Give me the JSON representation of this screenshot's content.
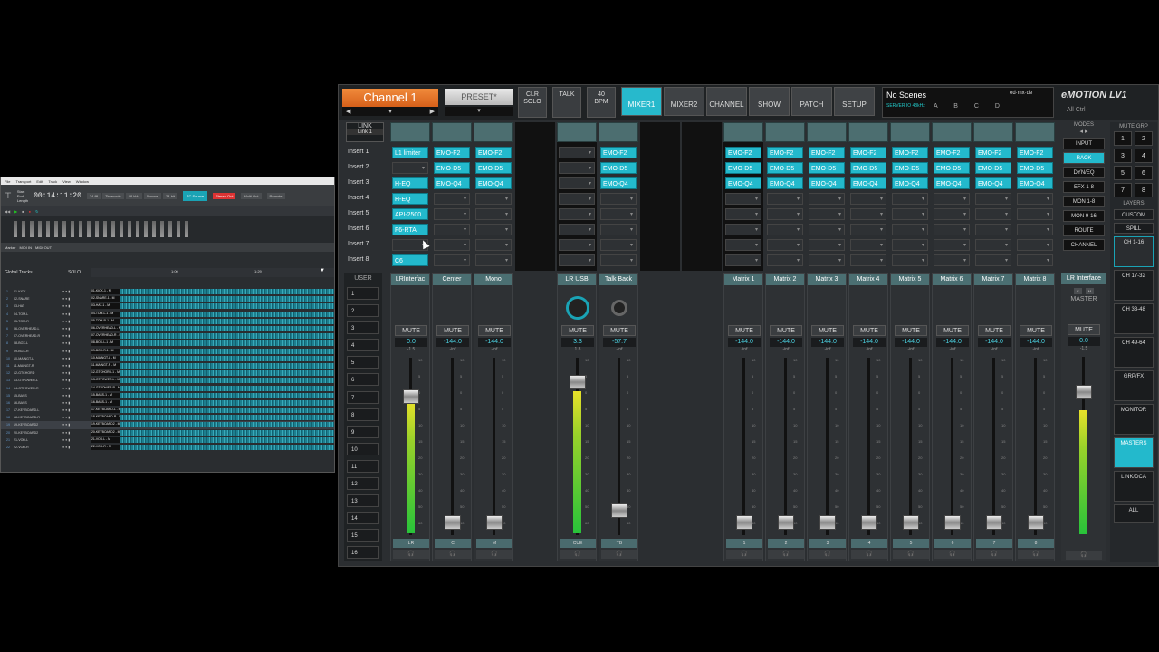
{
  "daw": {
    "menu": [
      "File",
      "Transport",
      "Edit",
      "Track",
      "View",
      "Window"
    ],
    "timecode": "00:14:11:20",
    "fields": [
      "Start",
      "End",
      "Length"
    ],
    "info_boxes": [
      "24 fill",
      "Timecode",
      "48 kHz",
      "Normal",
      "24-bit"
    ],
    "tc_source": "TC Source",
    "stereo_out": "Stereo Out",
    "multi_out": "Multi Out",
    "remote": "Remote",
    "marker_items": [
      "Marker",
      "MIDI IN",
      "MIDI OUT"
    ],
    "global_tracks": "Global Tracks",
    "solo": "SOLO",
    "ruler": [
      "1:00",
      "1:29"
    ],
    "tracks": [
      {
        "num": "1",
        "name": "01-KICK",
        "clip": "01-KICK-1 - M"
      },
      {
        "num": "2",
        "name": "02-SNARE",
        "clip": "02-SNARE-1 - M"
      },
      {
        "num": "3",
        "name": "03-HAT",
        "clip": "03-HAT-1 - M"
      },
      {
        "num": "4",
        "name": "04-TOM-L",
        "clip": "04-TOM-L-1 - M"
      },
      {
        "num": "5",
        "name": "05-TOM-R",
        "clip": "05-TOM-R-1 - M"
      },
      {
        "num": "6",
        "name": "06-OVERHEAD-L",
        "clip": "06-OVERHEAD-L - M"
      },
      {
        "num": "7",
        "name": "07-OVERHEAD-R",
        "clip": "07-OVERHEAD-R - M"
      },
      {
        "num": "8",
        "name": "08-BOX-L",
        "clip": "08-BOX-L-1 - M"
      },
      {
        "num": "9",
        "name": "09-BOX-R",
        "clip": "09-BOX-R-1 - M"
      },
      {
        "num": "10",
        "name": "10-MAINGT-L",
        "clip": "10-MAINGT-L - M"
      },
      {
        "num": "11",
        "name": "11-MAINGT-R",
        "clip": "11-MAINGT-R - M"
      },
      {
        "num": "12",
        "name": "12-GTCHORD",
        "clip": "12-GTCHORD-1 - M"
      },
      {
        "num": "13",
        "name": "13-GTPOWER-L",
        "clip": "13-GTPOWER-L - M"
      },
      {
        "num": "14",
        "name": "14-GTPOWER-R",
        "clip": "14-GTPOWER-R - M"
      },
      {
        "num": "15",
        "name": "15-BASS",
        "clip": "15-BASS-1 - M"
      },
      {
        "num": "16",
        "name": "16-BASS",
        "clip": "16-BASS-1 - M"
      },
      {
        "num": "17",
        "name": "17-KEYBOARD-L",
        "clip": "17-KEYBOARD-L - M"
      },
      {
        "num": "18",
        "name": "18-KEYBOARD-R",
        "clip": "18-KEYBOARD-R - M"
      },
      {
        "num": "19",
        "name": "19-KEYBOARD2",
        "clip": "19-KEYBOARD2 - M"
      },
      {
        "num": "20",
        "name": "20-KEYBOARD2",
        "clip": "20-KEYBOARD2 - M"
      },
      {
        "num": "21",
        "name": "21-VOD-L",
        "clip": "21-VOD-L - M"
      },
      {
        "num": "22",
        "name": "22-VOD-R",
        "clip": "22-VOD-R - M"
      }
    ]
  },
  "mixer": {
    "channel_name": "Channel 1",
    "preset": "PRESET*",
    "clr_solo": "CLR\nSOLO",
    "talk": "TALK",
    "bpm": "40\nBPM",
    "tap": "TAP",
    "tabs": [
      {
        "label": "MIXER1",
        "active": true
      },
      {
        "label": "MIXER2",
        "active": false
      },
      {
        "label": "CHANNEL",
        "active": false
      },
      {
        "label": "SHOW",
        "active": false
      },
      {
        "label": "PATCH",
        "active": false
      },
      {
        "label": "SETUP",
        "active": false
      }
    ],
    "scenes": "No Scenes",
    "server": "SERVER IO  48kHz",
    "abcd": "A B C D",
    "brand": "ed·mx·de",
    "logo": "eMOTION LV1",
    "all_ctrl": "All  Ctrl",
    "link": "LINK",
    "link_sel": "Link 1",
    "insert_labels": [
      "Insert 1",
      "Insert 2",
      "Insert 3",
      "Insert 4",
      "Insert 5",
      "Insert 6",
      "Insert 7",
      "Insert 8"
    ],
    "user": "USER",
    "user_buttons": [
      "1",
      "2",
      "3",
      "4",
      "5",
      "6",
      "7",
      "8",
      "9",
      "10",
      "11",
      "12",
      "13",
      "14",
      "15",
      "16"
    ],
    "modes_title": "MODES",
    "modes": [
      {
        "label": "INPUT",
        "active": false
      },
      {
        "label": "RACK",
        "active": true
      },
      {
        "label": "DYN/EQ",
        "active": false
      },
      {
        "label": "EFX 1-8",
        "active": false
      },
      {
        "label": "MON 1-8",
        "active": false
      },
      {
        "label": "MON 9-16",
        "active": false
      },
      {
        "label": "ROUTE",
        "active": false
      },
      {
        "label": "CHANNEL",
        "active": false
      }
    ],
    "mute_grp": "MUTE GRP",
    "mute_nums": [
      "1",
      "2",
      "3",
      "4",
      "5",
      "6",
      "7",
      "8"
    ],
    "layers_title": "LAYERS",
    "layers": [
      {
        "label": "CUSTOM",
        "style": "normal"
      },
      {
        "label": "SPILL",
        "style": "normal"
      },
      {
        "label": "CH 1-16",
        "style": "active2"
      },
      {
        "label": "CH 17-32",
        "style": "normal"
      },
      {
        "label": "CH 33-48",
        "style": "normal"
      },
      {
        "label": "CH 49-64",
        "style": "normal"
      },
      {
        "label": "GRP/FX",
        "style": "normal"
      },
      {
        "label": "MONITOR",
        "style": "normal"
      },
      {
        "label": "MASTERS",
        "style": "active"
      },
      {
        "label": "LINK/DCA",
        "style": "normal"
      },
      {
        "label": "ALL",
        "style": "normal"
      }
    ],
    "scale_marks": [
      "10",
      "5",
      "0",
      "5",
      "10",
      "15",
      "20",
      "30",
      "40",
      "50",
      "60"
    ],
    "strips": [
      {
        "name": "LRInterfac",
        "mute": "MUTE",
        "value": "0.0",
        "peak": "-1.5",
        "meter": 0.75,
        "fader": 0.78,
        "label": "LR",
        "inserts": [
          "L1 limiter",
          "",
          "H-EQ",
          "H-EQ",
          "API-2500",
          "F6-RTA",
          "",
          "C6"
        ]
      },
      {
        "name": "Center",
        "mute": "MUTE",
        "value": "-144.0",
        "peak": "-inf",
        "meter": 0,
        "fader": 0.07,
        "label": "C",
        "inserts": [
          "EMO-F2",
          "EMO-D5",
          "EMO-Q4",
          "",
          "",
          "",
          "",
          ""
        ]
      },
      {
        "name": "Mono",
        "mute": "MUTE",
        "value": "-144.0",
        "peak": "-inf",
        "meter": 0,
        "fader": 0.07,
        "label": "M",
        "inserts": [
          "EMO-F2",
          "EMO-D5",
          "EMO-Q4",
          "",
          "",
          "",
          "",
          ""
        ]
      },
      {
        "name": "LR USB",
        "mute": "MUTE",
        "value": "3.3",
        "peak": "1.8",
        "meter": 0.8,
        "fader": 0.86,
        "label": "CUE",
        "knob": true,
        "inserts": [
          "",
          "",
          "",
          "",
          "",
          "",
          "",
          ""
        ]
      },
      {
        "name": "Talk Back",
        "mute": "MUTE",
        "value": "-57.7",
        "peak": "-inf",
        "meter": 0,
        "fader": 0.14,
        "label": "TB",
        "knob": true,
        "inserts": [
          "EMO-F2",
          "EMO-D5",
          "EMO-Q4",
          "",
          "",
          "",
          "",
          ""
        ]
      },
      {
        "name": "Matrix 1",
        "mute": "MUTE",
        "value": "-144.0",
        "peak": "-inf",
        "meter": 0,
        "fader": 0.07,
        "label": "1",
        "inserts": [
          "EMO-F2",
          "EMO-D5",
          "EMO-Q4",
          "",
          "",
          "",
          "",
          ""
        ]
      },
      {
        "name": "Matrix 2",
        "mute": "MUTE",
        "value": "-144.0",
        "peak": "-inf",
        "meter": 0,
        "fader": 0.07,
        "label": "2",
        "inserts": [
          "EMO-F2",
          "EMO-D5",
          "EMO-Q4",
          "",
          "",
          "",
          "",
          ""
        ]
      },
      {
        "name": "Matrix 3",
        "mute": "MUTE",
        "value": "-144.0",
        "peak": "-inf",
        "meter": 0,
        "fader": 0.07,
        "label": "3",
        "inserts": [
          "EMO-F2",
          "EMO-D5",
          "EMO-Q4",
          "",
          "",
          "",
          "",
          ""
        ]
      },
      {
        "name": "Matrix 4",
        "mute": "MUTE",
        "value": "-144.0",
        "peak": "-inf",
        "meter": 0,
        "fader": 0.07,
        "label": "4",
        "inserts": [
          "EMO-F2",
          "EMO-D5",
          "EMO-Q4",
          "",
          "",
          "",
          "",
          ""
        ]
      },
      {
        "name": "Matrix 5",
        "mute": "MUTE",
        "value": "-144.0",
        "peak": "-inf",
        "meter": 0,
        "fader": 0.07,
        "label": "5",
        "inserts": [
          "EMO-F2",
          "EMO-D5",
          "EMO-Q4",
          "",
          "",
          "",
          "",
          ""
        ]
      },
      {
        "name": "Matrix 6",
        "mute": "MUTE",
        "value": "-144.0",
        "peak": "-inf",
        "meter": 0,
        "fader": 0.07,
        "label": "6",
        "inserts": [
          "EMO-F2",
          "EMO-D5",
          "EMO-Q4",
          "",
          "",
          "",
          "",
          ""
        ]
      },
      {
        "name": "Matrix 7",
        "mute": "MUTE",
        "value": "-144.0",
        "peak": "-inf",
        "meter": 0,
        "fader": 0.07,
        "label": "7",
        "inserts": [
          "EMO-F2",
          "EMO-D5",
          "EMO-Q4",
          "",
          "",
          "",
          "",
          ""
        ]
      },
      {
        "name": "Matrix 8",
        "mute": "MUTE",
        "value": "-144.0",
        "peak": "-inf",
        "meter": 0,
        "fader": 0.07,
        "label": "8",
        "inserts": [
          "EMO-F2",
          "EMO-D5",
          "EMO-Q4",
          "",
          "",
          "",
          "",
          ""
        ]
      }
    ],
    "master": {
      "name": "LR Interface",
      "c": "C",
      "m": "M",
      "title": "MASTER",
      "mute": "MUTE",
      "value": "0.0",
      "peak": "-1.5",
      "meter": 0.7,
      "fader": 0.8
    }
  }
}
